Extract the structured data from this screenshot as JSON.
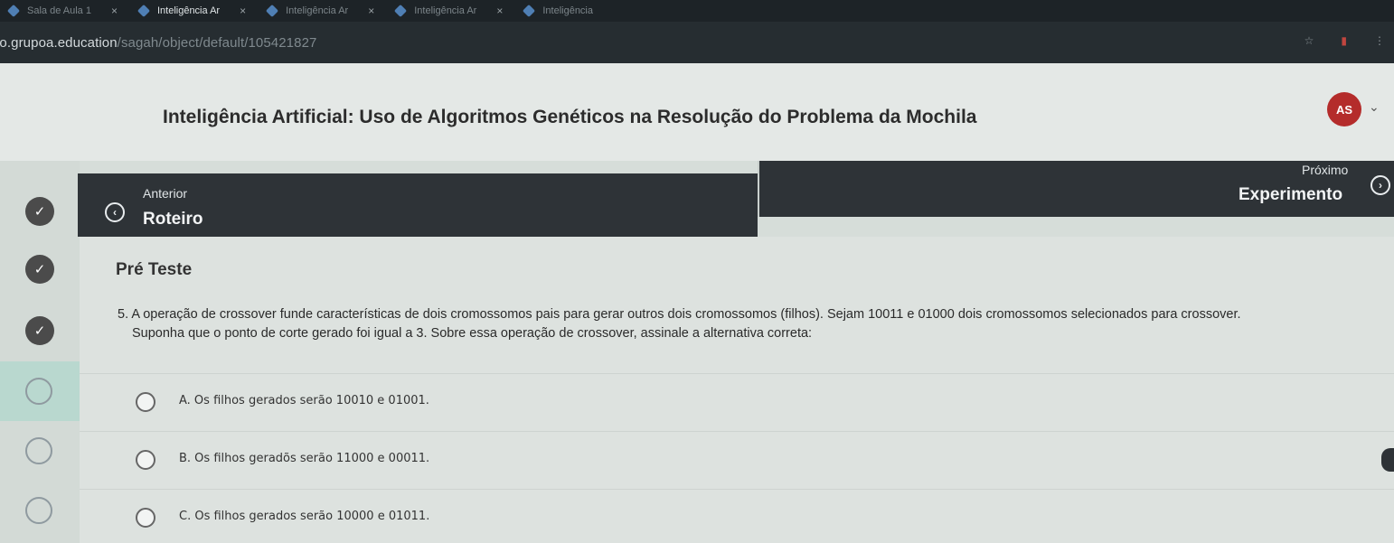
{
  "browser": {
    "tabs": [
      {
        "label": "Sala de Aula 1",
        "active": false
      },
      {
        "label": "Inteligência Ar",
        "active": true
      },
      {
        "label": "Inteligência Ar",
        "active": false
      },
      {
        "label": "Inteligência Ar",
        "active": false
      },
      {
        "label": "Inteligência",
        "active": false
      }
    ],
    "close_glyph": "×",
    "url_host": "io.grupoa.education",
    "url_path": "/sagah/object/default/105421827"
  },
  "header": {
    "title": "Inteligência Artificial: Uso de Algoritmos Genéticos na Resolução do Problema da Mochila",
    "avatar_initials": "AS",
    "avatar_color": "#b42c2b"
  },
  "nav": {
    "prev_label": "Anterior",
    "prev_title": "Roteiro",
    "next_label": "Próximo",
    "next_title": "Experimento",
    "prev_icon": "chevron-left-circle-icon",
    "next_icon": "chevron-right-circle-icon"
  },
  "content": {
    "section_title": "Pré Teste",
    "question_line1": "5. A operação de crossover funde características de dois cromossomos pais para gerar outros dois cromossomos (filhos). Sejam 10011 e 01000 dois cromossomos selecionados para crossover.",
    "question_line2": "Suponha que o ponto de corte gerado foi igual a 3. Sobre essa operação de crossover, assinale a alternativa correta:",
    "options": [
      {
        "text": "A. Os filhos gerados serão 10010 e 01001."
      },
      {
        "text": "B. Os filhos geradõs serão 11000 e 00011."
      },
      {
        "text": "C. Os filhos gerados serão 10000 e 01011."
      }
    ]
  },
  "colors": {
    "nav_bg": "#2e3337",
    "progress_done": "#4b4b4b",
    "progress_current_bg": "#b9d8cf"
  }
}
